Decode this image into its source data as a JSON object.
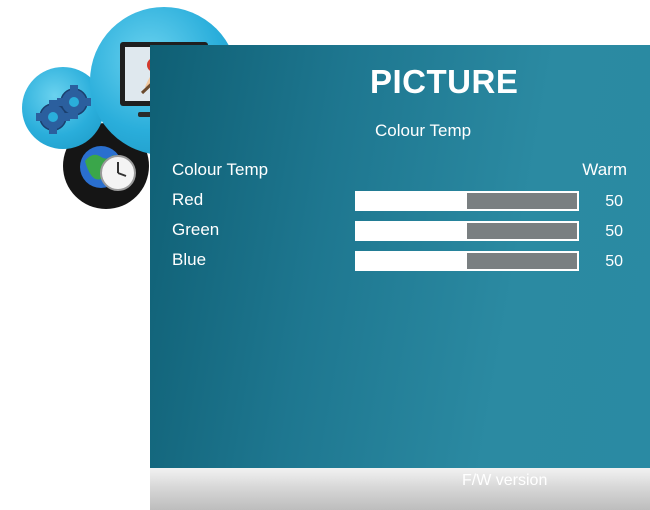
{
  "menu": {
    "title": "PICTURE",
    "subtitle": "Colour Temp",
    "colour_temp": {
      "label": "Colour Temp",
      "value": "Warm"
    },
    "sliders": [
      {
        "label": "Red",
        "value": "50",
        "fraction": 0.5
      },
      {
        "label": "Green",
        "value": "50",
        "fraction": 0.5
      },
      {
        "label": "Blue",
        "value": "50",
        "fraction": 0.5
      }
    ],
    "footer": {
      "text": "F/W version"
    }
  },
  "icons": [
    "gear-icon",
    "globe-clock-icon",
    "monitor-picture-icon"
  ],
  "colors": {
    "panel": "#1e7790",
    "accent_circle": "#2aaedb",
    "slider_track": "#7a7f81",
    "slider_fill": "#ffffff"
  }
}
